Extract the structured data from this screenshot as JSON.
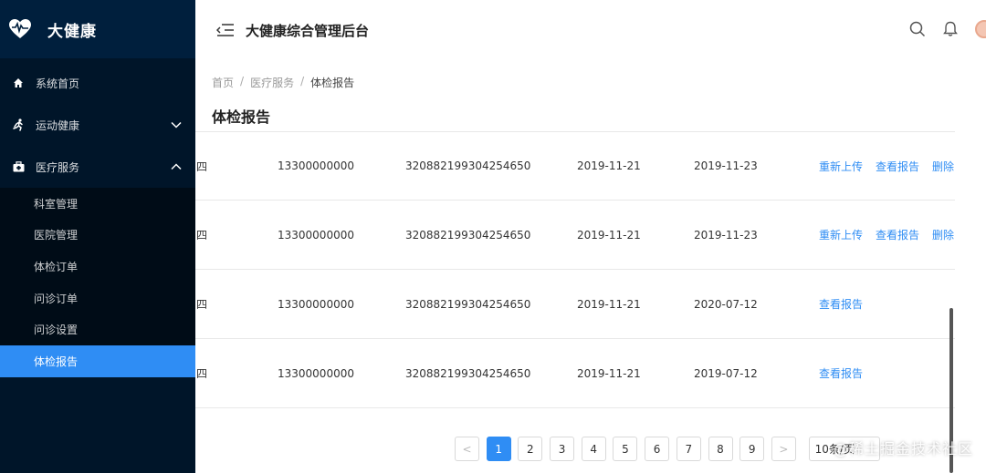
{
  "sidebar": {
    "logo_text": "大健康",
    "items": [
      {
        "label": "系统首页"
      },
      {
        "label": "运动健康"
      },
      {
        "label": "医疗服务"
      }
    ],
    "submenu": [
      {
        "label": "科室管理"
      },
      {
        "label": "医院管理"
      },
      {
        "label": "体检订单"
      },
      {
        "label": "问诊订单"
      },
      {
        "label": "问诊设置"
      },
      {
        "label": "体检报告"
      }
    ]
  },
  "header": {
    "title": "大健康综合管理后台"
  },
  "breadcrumb": {
    "items": [
      "首页",
      "医疗服务",
      "体检报告"
    ],
    "sep": "/"
  },
  "page": {
    "title": "体检报告"
  },
  "table": {
    "rows": [
      {
        "name": "四",
        "phone": "13300000000",
        "id_no": "320882199304254650",
        "date1": "2019-11-21",
        "date2": "2019-11-23",
        "ops": [
          "重新上传",
          "查看报告",
          "删除"
        ]
      },
      {
        "name": "四",
        "phone": "13300000000",
        "id_no": "320882199304254650",
        "date1": "2019-11-21",
        "date2": "2019-11-23",
        "ops": [
          "重新上传",
          "查看报告",
          "删除"
        ]
      },
      {
        "name": "四",
        "phone": "13300000000",
        "id_no": "320882199304254650",
        "date1": "2019-11-21",
        "date2": "2020-07-12",
        "ops": [
          "查看报告"
        ]
      },
      {
        "name": "四",
        "phone": "13300000000",
        "id_no": "320882199304254650",
        "date1": "2019-11-21",
        "date2": "2019-07-12",
        "ops": [
          "查看报告"
        ]
      }
    ]
  },
  "pagination": {
    "pages": [
      "1",
      "2",
      "3",
      "4",
      "5",
      "6",
      "7",
      "8",
      "9"
    ],
    "prev": "<",
    "next": ">",
    "page_size": "10条/页",
    "current": "1"
  },
  "watermark": "@稀土掘金技术社区",
  "colors": {
    "sidebar_bg": "#001529",
    "accent": "#2f8df4"
  }
}
